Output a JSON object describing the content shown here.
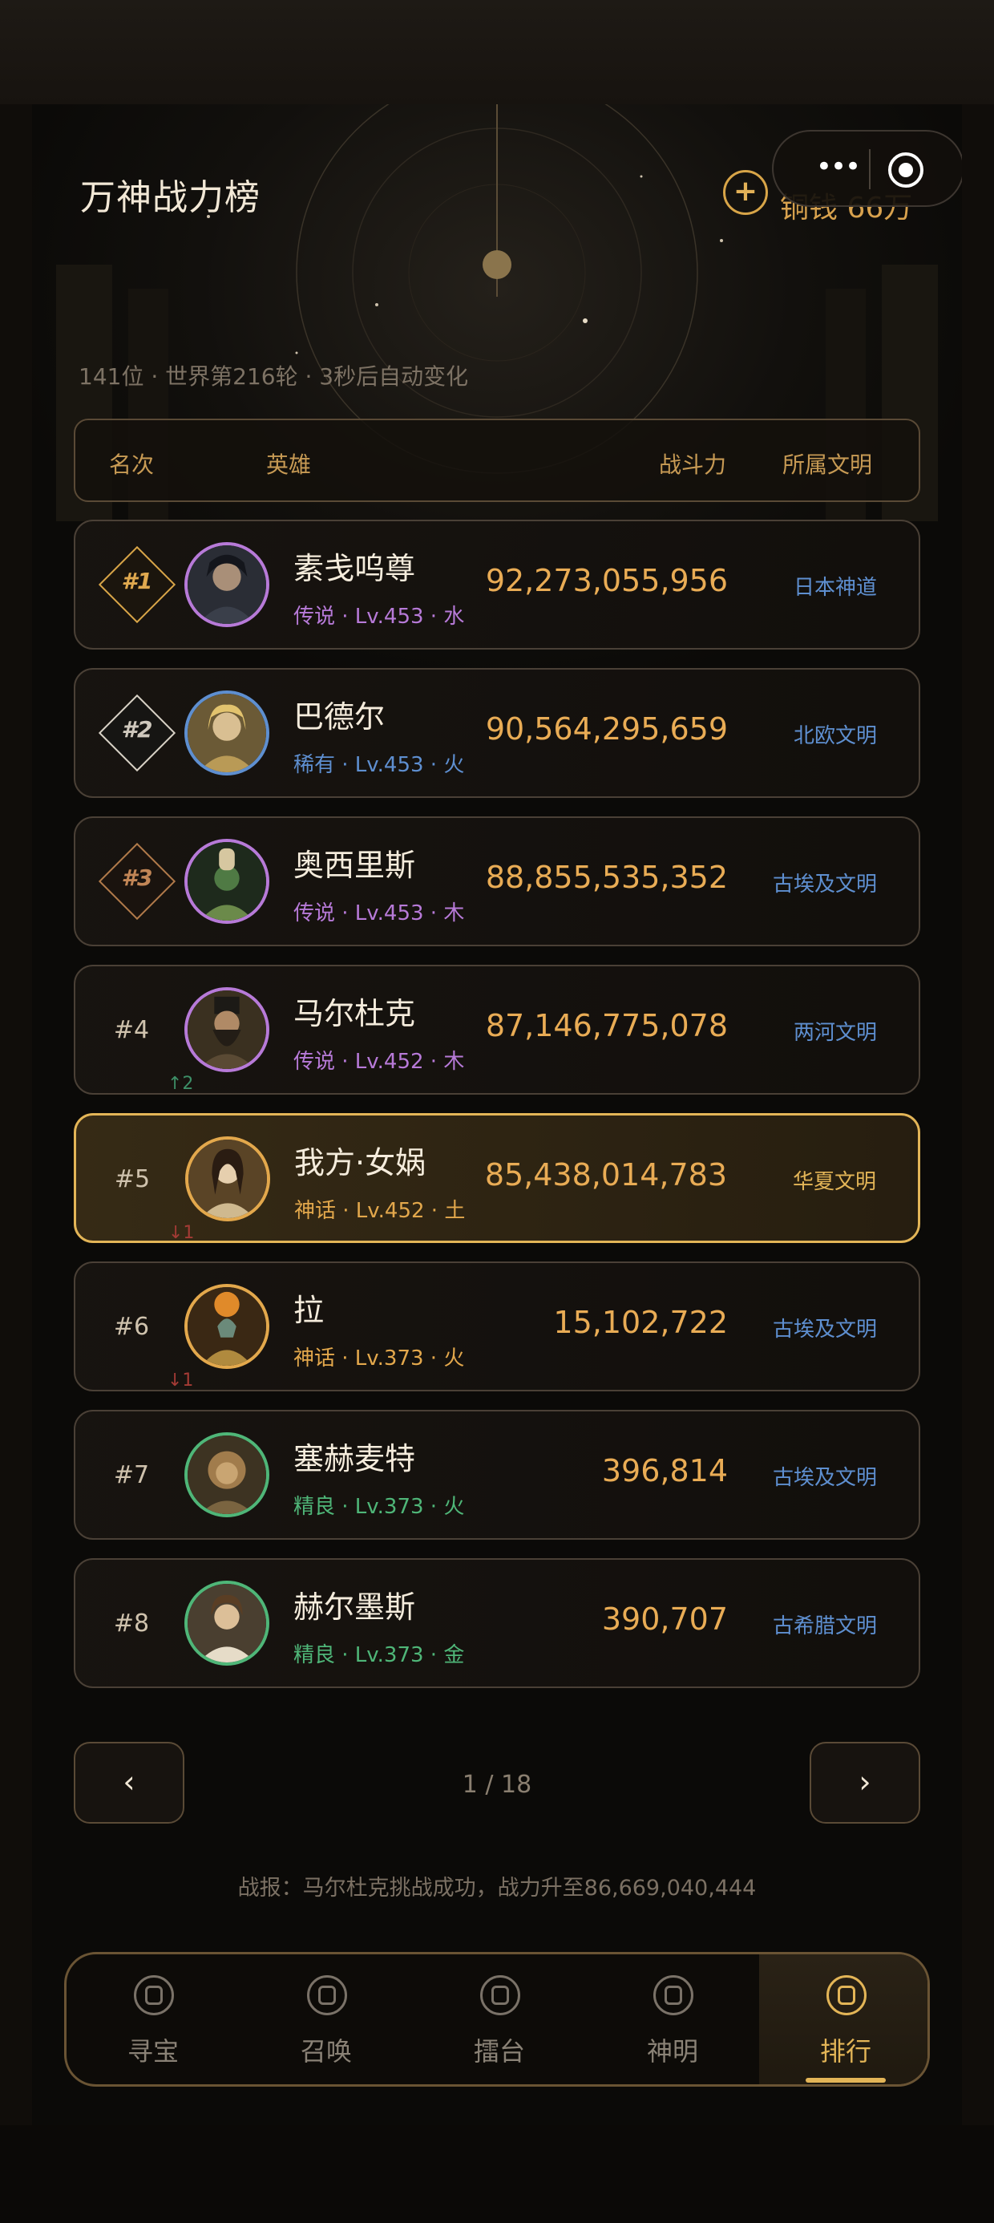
{
  "header": {
    "title": "万神战力榜",
    "coin_button_icon": "plus-icon",
    "coin_button_glyph": "+",
    "coin_text": "铜钱 66万"
  },
  "capsule": {
    "more_glyph": "•••",
    "more_icon": "more-dots-icon",
    "close_icon": "target-close-icon"
  },
  "subtitle": "141位 · 世界第216轮 · 3秒后自动变化",
  "table_header": {
    "rank": "名次",
    "hero": "英雄",
    "power": "战斗力",
    "civ": "所属文明"
  },
  "colors": {
    "gold": "#e3b557",
    "legend": "#b77ad8",
    "rare": "#5e8fd0",
    "myth": "#e3a84c",
    "fine": "#4fb678",
    "up": "#3d8f67",
    "down": "#a43b35"
  },
  "rows": [
    {
      "rank": "#1",
      "name": "素戋呜尊",
      "meta": "传说 · Lv.453 · 水",
      "power": "92,273,055,956",
      "civ": "日本神道",
      "change": ""
    },
    {
      "rank": "#2",
      "name": "巴德尔",
      "meta": "稀有 · Lv.453 · 火",
      "power": "90,564,295,659",
      "civ": "北欧文明",
      "change": ""
    },
    {
      "rank": "#3",
      "name": "奥西里斯",
      "meta": "传说 · Lv.453 · 木",
      "power": "88,855,535,352",
      "civ": "古埃及文明",
      "change": ""
    },
    {
      "rank": "#4",
      "name": "马尔杜克",
      "meta": "传说 · Lv.452 · 木",
      "power": "87,146,775,078",
      "civ": "两河文明",
      "change": "↑2"
    },
    {
      "rank": "#5",
      "name": "我方·女娲",
      "meta": "神话 · Lv.452 · 土",
      "power": "85,438,014,783",
      "civ": "华夏文明",
      "change": "↓1"
    },
    {
      "rank": "#6",
      "name": "拉",
      "meta": "神话 · Lv.373 · 火",
      "power": "15,102,722",
      "civ": "古埃及文明",
      "change": "↓1"
    },
    {
      "rank": "#7",
      "name": "塞赫麦特",
      "meta": "精良 · Lv.373 · 火",
      "power": "396,814",
      "civ": "古埃及文明",
      "change": ""
    },
    {
      "rank": "#8",
      "name": "赫尔墨斯",
      "meta": "精良 · Lv.373 · 金",
      "power": "390,707",
      "civ": "古希腊文明",
      "change": ""
    }
  ],
  "pagination": {
    "prev_glyph": "‹",
    "next_glyph": "›",
    "indicator": "1 / 18"
  },
  "battle_report": "战报：马尔杜克挑战成功，战力升至86,669,040,444",
  "nav": {
    "items": [
      {
        "label": "寻宝",
        "icon": "treasure-icon"
      },
      {
        "label": "召唤",
        "icon": "summon-icon"
      },
      {
        "label": "擂台",
        "icon": "arena-icon"
      },
      {
        "label": "神明",
        "icon": "deity-icon"
      },
      {
        "label": "排行",
        "icon": "ranking-icon"
      }
    ],
    "active_index": 4
  }
}
